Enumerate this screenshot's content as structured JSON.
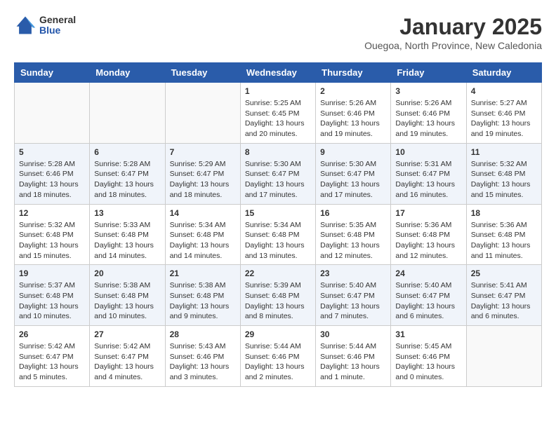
{
  "header": {
    "logo_general": "General",
    "logo_blue": "Blue",
    "month": "January 2025",
    "location": "Ouegoa, North Province, New Caledonia"
  },
  "weekdays": [
    "Sunday",
    "Monday",
    "Tuesday",
    "Wednesday",
    "Thursday",
    "Friday",
    "Saturday"
  ],
  "weeks": [
    [
      {
        "day": "",
        "info": ""
      },
      {
        "day": "",
        "info": ""
      },
      {
        "day": "",
        "info": ""
      },
      {
        "day": "1",
        "info": "Sunrise: 5:25 AM\nSunset: 6:45 PM\nDaylight: 13 hours\nand 20 minutes."
      },
      {
        "day": "2",
        "info": "Sunrise: 5:26 AM\nSunset: 6:46 PM\nDaylight: 13 hours\nand 19 minutes."
      },
      {
        "day": "3",
        "info": "Sunrise: 5:26 AM\nSunset: 6:46 PM\nDaylight: 13 hours\nand 19 minutes."
      },
      {
        "day": "4",
        "info": "Sunrise: 5:27 AM\nSunset: 6:46 PM\nDaylight: 13 hours\nand 19 minutes."
      }
    ],
    [
      {
        "day": "5",
        "info": "Sunrise: 5:28 AM\nSunset: 6:46 PM\nDaylight: 13 hours\nand 18 minutes."
      },
      {
        "day": "6",
        "info": "Sunrise: 5:28 AM\nSunset: 6:47 PM\nDaylight: 13 hours\nand 18 minutes."
      },
      {
        "day": "7",
        "info": "Sunrise: 5:29 AM\nSunset: 6:47 PM\nDaylight: 13 hours\nand 18 minutes."
      },
      {
        "day": "8",
        "info": "Sunrise: 5:30 AM\nSunset: 6:47 PM\nDaylight: 13 hours\nand 17 minutes."
      },
      {
        "day": "9",
        "info": "Sunrise: 5:30 AM\nSunset: 6:47 PM\nDaylight: 13 hours\nand 17 minutes."
      },
      {
        "day": "10",
        "info": "Sunrise: 5:31 AM\nSunset: 6:47 PM\nDaylight: 13 hours\nand 16 minutes."
      },
      {
        "day": "11",
        "info": "Sunrise: 5:32 AM\nSunset: 6:48 PM\nDaylight: 13 hours\nand 15 minutes."
      }
    ],
    [
      {
        "day": "12",
        "info": "Sunrise: 5:32 AM\nSunset: 6:48 PM\nDaylight: 13 hours\nand 15 minutes."
      },
      {
        "day": "13",
        "info": "Sunrise: 5:33 AM\nSunset: 6:48 PM\nDaylight: 13 hours\nand 14 minutes."
      },
      {
        "day": "14",
        "info": "Sunrise: 5:34 AM\nSunset: 6:48 PM\nDaylight: 13 hours\nand 14 minutes."
      },
      {
        "day": "15",
        "info": "Sunrise: 5:34 AM\nSunset: 6:48 PM\nDaylight: 13 hours\nand 13 minutes."
      },
      {
        "day": "16",
        "info": "Sunrise: 5:35 AM\nSunset: 6:48 PM\nDaylight: 13 hours\nand 12 minutes."
      },
      {
        "day": "17",
        "info": "Sunrise: 5:36 AM\nSunset: 6:48 PM\nDaylight: 13 hours\nand 12 minutes."
      },
      {
        "day": "18",
        "info": "Sunrise: 5:36 AM\nSunset: 6:48 PM\nDaylight: 13 hours\nand 11 minutes."
      }
    ],
    [
      {
        "day": "19",
        "info": "Sunrise: 5:37 AM\nSunset: 6:48 PM\nDaylight: 13 hours\nand 10 minutes."
      },
      {
        "day": "20",
        "info": "Sunrise: 5:38 AM\nSunset: 6:48 PM\nDaylight: 13 hours\nand 10 minutes."
      },
      {
        "day": "21",
        "info": "Sunrise: 5:38 AM\nSunset: 6:48 PM\nDaylight: 13 hours\nand 9 minutes."
      },
      {
        "day": "22",
        "info": "Sunrise: 5:39 AM\nSunset: 6:48 PM\nDaylight: 13 hours\nand 8 minutes."
      },
      {
        "day": "23",
        "info": "Sunrise: 5:40 AM\nSunset: 6:47 PM\nDaylight: 13 hours\nand 7 minutes."
      },
      {
        "day": "24",
        "info": "Sunrise: 5:40 AM\nSunset: 6:47 PM\nDaylight: 13 hours\nand 6 minutes."
      },
      {
        "day": "25",
        "info": "Sunrise: 5:41 AM\nSunset: 6:47 PM\nDaylight: 13 hours\nand 6 minutes."
      }
    ],
    [
      {
        "day": "26",
        "info": "Sunrise: 5:42 AM\nSunset: 6:47 PM\nDaylight: 13 hours\nand 5 minutes."
      },
      {
        "day": "27",
        "info": "Sunrise: 5:42 AM\nSunset: 6:47 PM\nDaylight: 13 hours\nand 4 minutes."
      },
      {
        "day": "28",
        "info": "Sunrise: 5:43 AM\nSunset: 6:46 PM\nDaylight: 13 hours\nand 3 minutes."
      },
      {
        "day": "29",
        "info": "Sunrise: 5:44 AM\nSunset: 6:46 PM\nDaylight: 13 hours\nand 2 minutes."
      },
      {
        "day": "30",
        "info": "Sunrise: 5:44 AM\nSunset: 6:46 PM\nDaylight: 13 hours\nand 1 minute."
      },
      {
        "day": "31",
        "info": "Sunrise: 5:45 AM\nSunset: 6:46 PM\nDaylight: 13 hours\nand 0 minutes."
      },
      {
        "day": "",
        "info": ""
      }
    ]
  ]
}
